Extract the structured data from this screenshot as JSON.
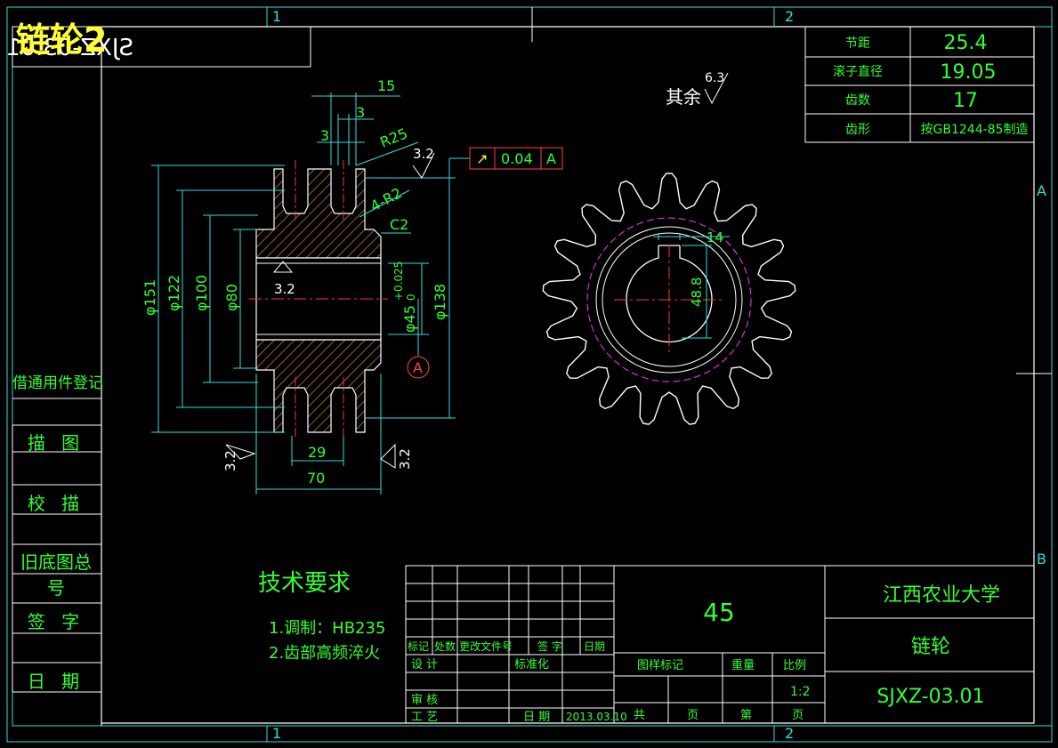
{
  "overlay_title": "链轮2",
  "mirrored_code": "SJXZ-03.01",
  "zones": {
    "top": [
      "1",
      "2"
    ],
    "side": [
      "A",
      "B"
    ]
  },
  "side_labels": [
    "借通用件登记",
    "描 图",
    "校 描",
    "旧底图总号",
    "签 字",
    "日 期"
  ],
  "params": [
    {
      "label": "节距",
      "value": "25.4"
    },
    {
      "label": "滚子直径",
      "value": "19.05"
    },
    {
      "label": "齿数",
      "value": "17"
    },
    {
      "label": "齿形",
      "value": "按GB1244-85制造"
    }
  ],
  "roughness_other": {
    "label": "其余",
    "value": "6.3"
  },
  "dims": {
    "top15": "15",
    "top3": "3",
    "top3b": "3",
    "r25": "R25",
    "r2": "4-R2",
    "c2": "C2",
    "d151": "φ151",
    "d122": "φ122",
    "d100": "φ100",
    "d80": "φ80",
    "d138": "φ138",
    "d45": "φ45",
    "tol_up": "+0.025",
    "tol_low": "0",
    "w29": "29",
    "w70": "70",
    "rough_bore": "3.2",
    "rough_top": "3.2",
    "rough_left": "3.2",
    "rough_right": "3.2",
    "datum": "A",
    "key_w": "14",
    "key_h": "48.8"
  },
  "tolerance_frame": {
    "symbol": "↗",
    "value": "0.04",
    "datum": "A"
  },
  "tech_req": {
    "title": "技术要求",
    "items": [
      "1.调制：HB235",
      "2.齿部高频淬火"
    ]
  },
  "title_block": {
    "material": "45",
    "school": "江西农业大学",
    "part_name": "链轮",
    "drawing_no": "SJXZ-03.01",
    "rev_headers": [
      "标记",
      "处数",
      "更改文件号",
      "签 字",
      "日期"
    ],
    "design": "设 计",
    "standardize": "标准化",
    "review": "审 核",
    "process": "工 艺",
    "date_label": "日 期",
    "date": "2013.03.10",
    "mark_label": "图样标记",
    "weight_label": "重量",
    "scale_label": "比例",
    "scale": "1:2",
    "total": "共",
    "sheet": "页",
    "no": "第",
    "sheet2": "页"
  }
}
